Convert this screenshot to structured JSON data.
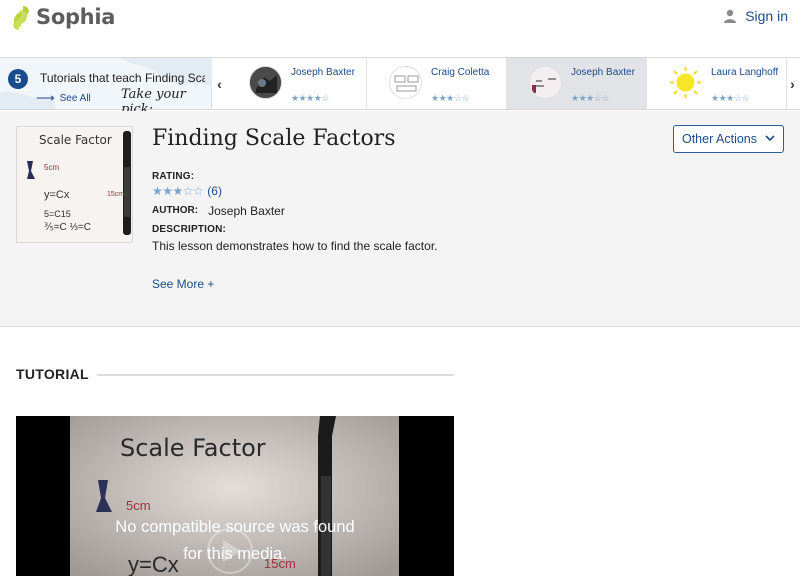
{
  "header": {
    "logo_text": "Sophia",
    "signin_label": "Sign in"
  },
  "carousel": {
    "count": "5",
    "title": "Tutorials that teach Finding Sca",
    "see_all": "See All",
    "pick": "Take your pick:",
    "items": [
      {
        "author": "Joseph Baxter",
        "stars": "★★★★☆"
      },
      {
        "author": "Craig Coletta",
        "stars": "★★★☆☆"
      },
      {
        "author": "Joseph Baxter",
        "stars": "★★★☆☆"
      },
      {
        "author": "Laura Langhoff",
        "stars": "★★★☆☆"
      }
    ]
  },
  "lesson": {
    "title": "Finding Scale Factors",
    "other_actions": "Other Actions",
    "rating_label": "RATING:",
    "rating_stars": "★★★☆☆",
    "rating_count": "(6)",
    "author_label": "AUTHOR:",
    "author": "Joseph Baxter",
    "description_label": "DESCRIPTION:",
    "description": "This lesson demonstrates how to find the scale factor.",
    "see_more": "See More +",
    "thumb": {
      "line1": "Scale Factor",
      "line2": "5cm",
      "line3": "y=Cx",
      "line4": "15cm",
      "line5": "5=C15",
      "line6": "⅗=C  ⅓=C"
    }
  },
  "tutorial": {
    "heading": "TUTORIAL",
    "video_message_1": "No compatible source was found",
    "video_message_2": "for this media.",
    "frame": {
      "title": "Scale Factor",
      "label1": "5cm",
      "label2": "y=Cx",
      "label3": "15cm"
    }
  },
  "colors": {
    "brand_green": "#b5d334",
    "link_blue": "#1a4b8c",
    "star_blue": "#7aa5cf"
  }
}
